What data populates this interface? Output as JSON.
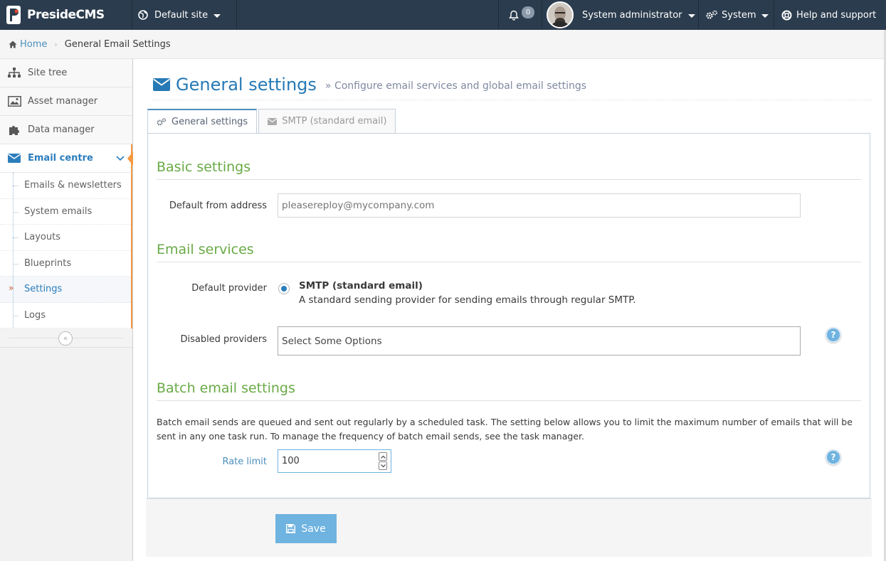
{
  "topbar": {
    "brand": "PresideCMS",
    "site_selector": "Default site",
    "notifications_count": "0",
    "user_name": "System administrator",
    "system_menu": "System",
    "help_menu": "Help and support"
  },
  "breadcrumb": {
    "home": "Home",
    "current": "General Email Settings"
  },
  "sidebar": {
    "items": [
      {
        "label": "Site tree",
        "icon": "sitemap-icon"
      },
      {
        "label": "Asset manager",
        "icon": "picture-icon"
      },
      {
        "label": "Data manager",
        "icon": "puzzle-icon"
      },
      {
        "label": "Email centre",
        "icon": "envelope-icon"
      }
    ],
    "email_sub": [
      "Emails & newsletters",
      "System emails",
      "Layouts",
      "Blueprints",
      "Settings",
      "Logs"
    ],
    "collapse_glyph": "«"
  },
  "page": {
    "title": "General settings",
    "subtitle": "» Configure email services and global email settings"
  },
  "tabs": {
    "general": "General settings",
    "smtp": "SMTP (standard email)"
  },
  "basic": {
    "heading": "Basic settings",
    "from_label": "Default from address",
    "from_placeholder": "pleasereploy@mycompany.com"
  },
  "services": {
    "heading": "Email services",
    "provider_label": "Default provider",
    "provider_name": "SMTP (standard email)",
    "provider_desc": "A standard sending provider for sending emails through regular SMTP.",
    "disabled_label": "Disabled providers",
    "disabled_placeholder": "Select Some Options"
  },
  "batch": {
    "heading": "Batch email settings",
    "description": "Batch email sends are queued and sent out regularly by a scheduled task. The setting below allows you to limit the maximum number of emails that will be sent in any one task run. To manage the frequency of batch email sends, see the task manager.",
    "rate_label": "Rate limit",
    "rate_value": "100"
  },
  "actions": {
    "save": "Save"
  },
  "colors": {
    "topbar": "#2b3c4e",
    "accent": "#2679b5",
    "section": "#69aa46",
    "active_marker": "#f59942",
    "save_button": "#6fb3e0"
  }
}
